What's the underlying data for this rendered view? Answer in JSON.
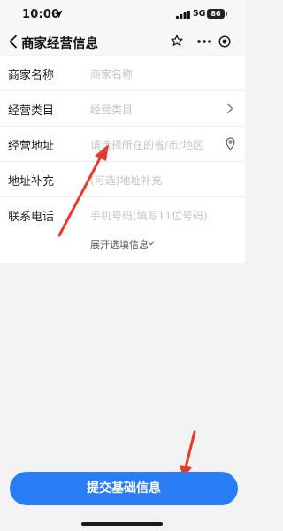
{
  "status_bar": {
    "time": "10:00",
    "network": "5G",
    "battery": "86"
  },
  "nav": {
    "title": "商家经营信息"
  },
  "form": {
    "rows": [
      {
        "label": "商家名称",
        "placeholder": "商家名称",
        "icon": null
      },
      {
        "label": "经营类目",
        "placeholder": "经营类目",
        "icon": "chevron-right-icon"
      },
      {
        "label": "经营地址",
        "placeholder": "请选择所在的省/市/地区",
        "icon": "location-pin-icon"
      },
      {
        "label": "地址补充",
        "placeholder": "(可选)地址补充",
        "icon": null
      },
      {
        "label": "联系电话",
        "placeholder": "手机号码(填写11位号码)",
        "icon": null
      }
    ],
    "expand_label": "展开选填信息"
  },
  "submit": {
    "label": "提交基础信息"
  },
  "colors": {
    "accent": "#2a7ef5",
    "annotation_arrow": "#e8392b"
  }
}
